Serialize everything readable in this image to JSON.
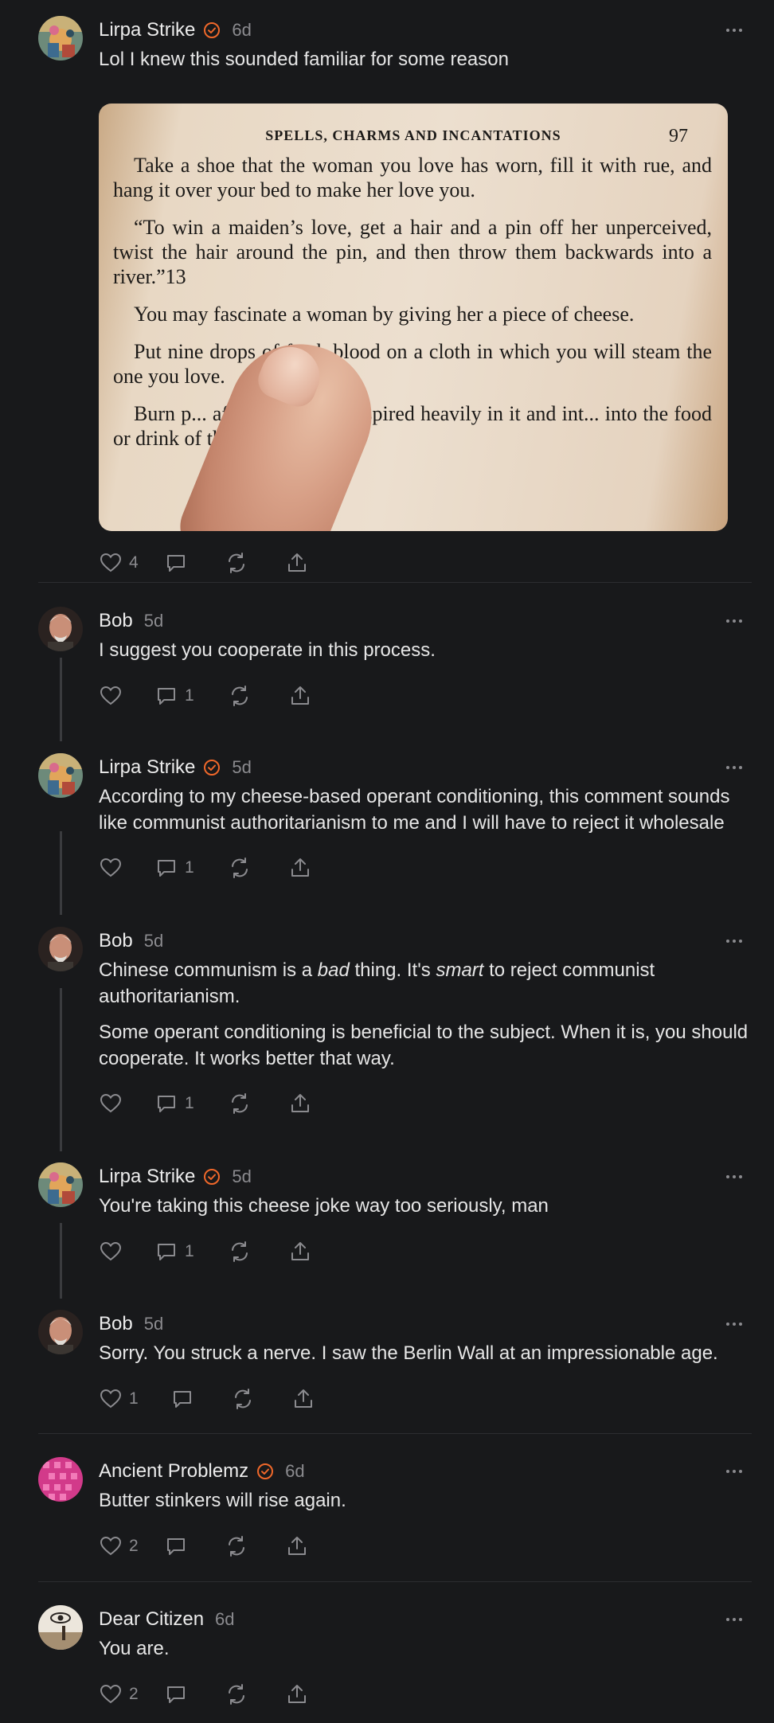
{
  "comments": [
    {
      "author": "Lirpa Strike",
      "verified": true,
      "time": "6d",
      "paragraphs": [
        "Lol I knew this sounded familiar for some reason"
      ],
      "likes": "4",
      "replies": "",
      "avatar_icon": "avatar-colorful-illustration"
    },
    {
      "author": "Bob",
      "verified": false,
      "time": "5d",
      "paragraphs": [
        "I suggest you cooperate in this process."
      ],
      "likes": "",
      "replies": "1",
      "avatar_icon": "avatar-photo-man"
    },
    {
      "author": "Lirpa Strike",
      "verified": true,
      "time": "5d",
      "paragraphs": [
        "According to my cheese-based operant conditioning, this comment sounds like communist authoritarianism to me and I will have to reject it wholesale"
      ],
      "likes": "",
      "replies": "1",
      "avatar_icon": "avatar-colorful-illustration"
    },
    {
      "author": "Bob",
      "verified": false,
      "time": "5d",
      "paragraphs_rich": [
        {
          "a": "Chinese communism is a ",
          "b": "bad",
          "c": " thing. It's ",
          "d": "smart",
          "e": " to reject communist authoritarianism."
        }
      ],
      "paragraphs": [
        "Some operant conditioning is beneficial to the subject. When it is, you should cooperate. It works better that way."
      ],
      "likes": "",
      "replies": "1",
      "avatar_icon": "avatar-photo-man"
    },
    {
      "author": "Lirpa Strike",
      "verified": true,
      "time": "5d",
      "paragraphs": [
        "You're taking this cheese joke way too seriously, man"
      ],
      "likes": "",
      "replies": "1",
      "avatar_icon": "avatar-colorful-illustration"
    },
    {
      "author": "Bob",
      "verified": false,
      "time": "5d",
      "paragraphs": [
        "Sorry. You struck a nerve. I saw the Berlin Wall at an impressionable age."
      ],
      "likes": "1",
      "replies": "",
      "avatar_icon": "avatar-photo-man"
    },
    {
      "author": "Ancient Problemz",
      "verified": true,
      "time": "6d",
      "paragraphs": [
        "Butter stinkers will rise again."
      ],
      "likes": "2",
      "replies": "",
      "avatar_icon": "avatar-pink-pattern"
    },
    {
      "author": "Dear Citizen",
      "verified": false,
      "time": "6d",
      "paragraphs": [
        "You are."
      ],
      "likes": "2",
      "replies": "",
      "avatar_icon": "avatar-eye-drawing"
    }
  ],
  "book_page": {
    "header": "SPELLS, CHARMS AND INCANTATIONS",
    "page_number": "97",
    "p1": "Take a shoe that the woman you love has worn, fill it with rue, and hang it over your bed to make her love you.",
    "p2": "“To win a maiden’s love, get a hair and a pin off her unperceived, twist the hair around the pin, and then throw them backwards into a river.”13",
    "p3": "You may fascinate a woman by giving her a piece of cheese.",
    "p4": "Put nine drops of fresh blood on a cloth in which you will steam the one you love.",
    "p5": "Burn p... after you have perspired heavily in it and int... into the food or drink of the man you ..."
  },
  "colors": {
    "background": "#18191b",
    "verified_badge": "#f0682a",
    "muted": "#8b8b8f"
  }
}
